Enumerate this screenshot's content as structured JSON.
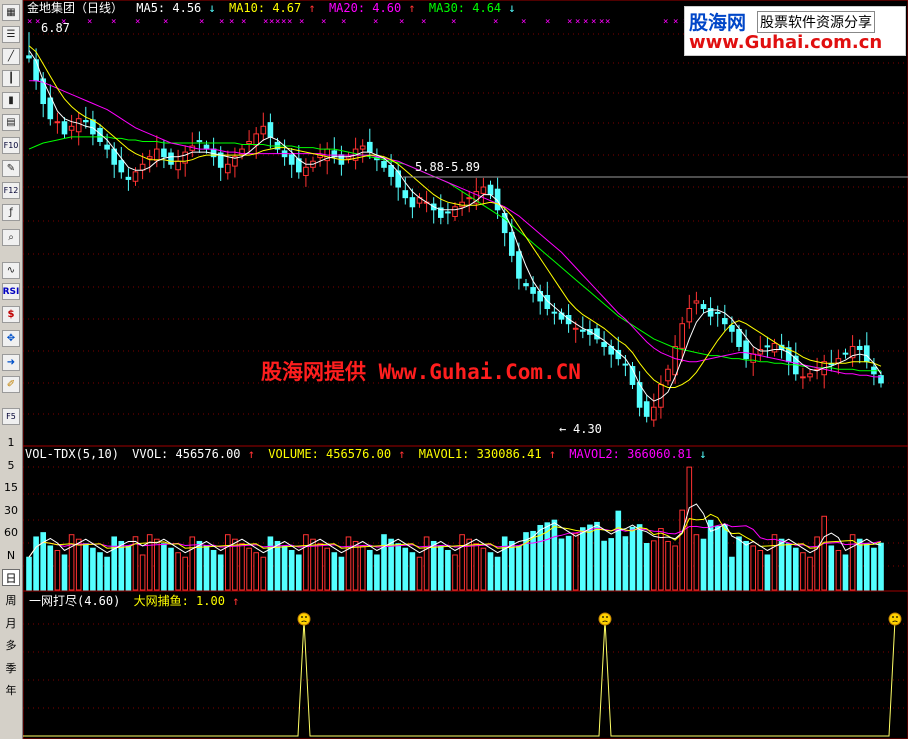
{
  "toolbar": {
    "icons": [
      "grid-icon",
      "list-icon",
      "line-chart-icon",
      "candle-chart-icon",
      "bar-chart-icon",
      "table-icon",
      "f10-icon",
      "notes-icon",
      "f12-icon",
      "function-icon",
      "zoom-icon",
      "indicator-icon",
      "rsi-icon",
      "dollar-icon",
      "move-icon",
      "export-icon",
      "pencil-icon",
      "f5-icon"
    ],
    "labels": {
      "rsi": "RSI",
      "f10": "F10",
      "f12": "F12",
      "f5": "F5"
    },
    "periods": [
      "1",
      "5",
      "15",
      "30",
      "60",
      "N",
      "日",
      "周",
      "月",
      "多",
      "季",
      "年"
    ],
    "selected_period": "日"
  },
  "main_legend": {
    "stock": "金地集团（日线）",
    "ma5": "MA5: 4.56",
    "ma5_arrow": "↓",
    "ma10": "MA10: 4.67",
    "ma10_arrow": "↑",
    "ma20": "MA20: 4.60",
    "ma20_arrow": "↑",
    "ma30": "MA30: 4.64",
    "ma30_arrow": "↓"
  },
  "vol_legend": {
    "name": "VOL-TDX(5,10)",
    "vvol": "VVOL: 456576.00",
    "vvol_arrow": "↑",
    "volume": "VOLUME: 456576.00",
    "volume_arrow": "↑",
    "mavol1": "MAVOL1: 330086.41",
    "mavol1_arrow": "↑",
    "mavol2": "MAVOL2: 366060.81",
    "mavol2_arrow": "↓"
  },
  "ind_legend": {
    "name": "一网打尽(4.60)",
    "value": "大网捕鱼: 1.00",
    "arrow": "↑"
  },
  "annotations": {
    "high": "6.87",
    "range": "5.88-5.89",
    "low": "4.30",
    "arrow": "←",
    "xmarks": "×"
  },
  "watermark": "股海网提供 Www.Guhai.Com.CN",
  "logo": {
    "brand": "股海网",
    "slogan": "股票软件资源分享",
    "url": "www.Guhai.com.cn"
  },
  "colors": {
    "up": "#ff3232",
    "down": "#54ffff",
    "ma5": "#ffffff",
    "ma10": "#ffff00",
    "ma20": "#ff00ff",
    "ma30": "#00ff00",
    "grid": "#800000",
    "axis": "#a00000"
  },
  "chart_data": [
    {
      "type": "candlestick",
      "panel": "price",
      "note": "Approximate daily candles, ~120 sessions",
      "key_levels": {
        "high": 6.87,
        "range": [
          5.88,
          5.89
        ],
        "low": 4.3
      },
      "series_last": {
        "MA5": 4.56,
        "MA10": 4.67,
        "MA20": 4.6,
        "MA30": 4.64
      },
      "close": [
        6.7,
        6.55,
        6.4,
        6.3,
        6.28,
        6.2,
        6.25,
        6.3,
        6.28,
        6.2,
        6.15,
        6.1,
        6.0,
        5.95,
        5.9,
        5.95,
        6.0,
        6.05,
        6.1,
        6.05,
        6.0,
        6.02,
        6.08,
        6.12,
        6.15,
        6.1,
        6.05,
        5.98,
        6.0,
        6.05,
        6.1,
        6.15,
        6.2,
        6.25,
        6.18,
        6.1,
        6.05,
        6.0,
        5.95,
        5.98,
        6.02,
        6.06,
        6.1,
        6.05,
        6.0,
        6.05,
        6.1,
        6.12,
        6.08,
        6.03,
        5.98,
        5.92,
        5.85,
        5.78,
        5.72,
        5.78,
        5.75,
        5.7,
        5.65,
        5.68,
        5.72,
        5.75,
        5.78,
        5.82,
        5.85,
        5.8,
        5.7,
        5.55,
        5.4,
        5.25,
        5.2,
        5.15,
        5.1,
        5.05,
        5.02,
        4.98,
        4.95,
        4.92,
        4.9,
        4.88,
        4.85,
        4.8,
        4.75,
        4.72,
        4.68,
        4.55,
        4.4,
        4.34,
        4.4,
        4.55,
        4.65,
        4.8,
        4.95,
        5.05,
        5.1,
        5.05,
        5.0,
        5.02,
        4.95,
        4.9,
        4.8,
        4.72,
        4.75,
        4.78,
        4.8,
        4.82,
        4.78,
        4.7,
        4.62,
        4.6,
        4.62,
        4.65,
        4.7,
        4.68,
        4.72,
        4.75,
        4.8,
        4.78,
        4.7,
        4.62,
        4.56
      ],
      "MA5": [
        6.75,
        6.68,
        6.55,
        6.45,
        6.35,
        6.3,
        6.28,
        6.27,
        6.25,
        6.24,
        6.2,
        6.16,
        6.1,
        6.04,
        5.98,
        5.96,
        5.96,
        5.98,
        6.02,
        6.04,
        6.05,
        6.05,
        6.06,
        6.08,
        6.08,
        6.08,
        6.07,
        6.06,
        6.05,
        6.04,
        6.05,
        6.08,
        6.12,
        6.16,
        6.18,
        6.16,
        6.12,
        6.08,
        6.03,
        6.0,
        6.0,
        6.02,
        6.04,
        6.05,
        6.05,
        6.05,
        6.06,
        6.08,
        6.08,
        6.06,
        6.04,
        6.0,
        5.95,
        5.88,
        5.82,
        5.78,
        5.75,
        5.72,
        5.7,
        5.7,
        5.7,
        5.71,
        5.73,
        5.76,
        5.8,
        5.8,
        5.76,
        5.68,
        5.58,
        5.45,
        5.33,
        5.23,
        5.16,
        5.1,
        5.06,
        5.02,
        4.98,
        4.95,
        4.92,
        4.9,
        4.87,
        4.84,
        4.8,
        4.76,
        4.72,
        4.65,
        4.55,
        4.48,
        4.44,
        4.46,
        4.5,
        4.6,
        4.72,
        4.85,
        4.96,
        5.02,
        5.04,
        5.04,
        5.02,
        4.98,
        4.92,
        4.86,
        4.8,
        4.77,
        4.77,
        4.78,
        4.78,
        4.76,
        4.72,
        4.68,
        4.65,
        4.64,
        4.66,
        4.67,
        4.69,
        4.71,
        4.74,
        4.75,
        4.74,
        4.69,
        4.62
      ],
      "MA10": [
        6.78,
        6.74,
        6.66,
        6.58,
        6.5,
        6.43,
        6.38,
        6.34,
        6.31,
        6.29,
        6.26,
        6.22,
        6.18,
        6.14,
        6.1,
        6.07,
        6.05,
        6.03,
        6.03,
        6.03,
        6.02,
        6.02,
        6.02,
        6.03,
        6.05,
        6.06,
        6.06,
        6.06,
        6.06,
        6.06,
        6.06,
        6.06,
        6.07,
        6.09,
        6.1,
        6.11,
        6.11,
        6.1,
        6.09,
        6.08,
        6.07,
        6.06,
        6.05,
        6.04,
        6.03,
        6.03,
        6.04,
        6.05,
        6.06,
        6.06,
        6.05,
        6.03,
        6.0,
        5.96,
        5.92,
        5.88,
        5.84,
        5.8,
        5.77,
        5.75,
        5.74,
        5.73,
        5.73,
        5.73,
        5.74,
        5.75,
        5.74,
        5.71,
        5.66,
        5.59,
        5.52,
        5.45,
        5.38,
        5.31,
        5.24,
        5.17,
        5.1,
        5.05,
        5.01,
        4.98,
        4.95,
        4.92,
        4.88,
        4.84,
        4.81,
        4.76,
        4.69,
        4.63,
        4.58,
        4.55,
        4.53,
        4.53,
        4.55,
        4.58,
        4.63,
        4.7,
        4.77,
        4.84,
        4.9,
        4.95,
        4.97,
        4.95,
        4.92,
        4.89,
        4.86,
        4.83,
        4.8,
        4.78,
        4.76,
        4.73,
        4.71,
        4.7,
        4.69,
        4.69,
        4.69,
        4.69,
        4.7,
        4.7,
        4.7,
        4.69,
        4.67
      ],
      "MA20": [
        6.55,
        6.55,
        6.54,
        6.52,
        6.5,
        6.48,
        6.46,
        6.44,
        6.42,
        6.4,
        6.38,
        6.36,
        6.33,
        6.3,
        6.27,
        6.24,
        6.22,
        6.2,
        6.18,
        6.16,
        6.14,
        6.13,
        6.12,
        6.11,
        6.1,
        6.1,
        6.1,
        6.09,
        6.08,
        6.08,
        6.07,
        6.07,
        6.07,
        6.07,
        6.07,
        6.07,
        6.07,
        6.07,
        6.07,
        6.07,
        6.07,
        6.07,
        6.06,
        6.06,
        6.06,
        6.06,
        6.06,
        6.06,
        6.06,
        6.05,
        6.04,
        6.03,
        6.02,
        6.0,
        5.98,
        5.96,
        5.94,
        5.92,
        5.9,
        5.88,
        5.86,
        5.84,
        5.82,
        5.8,
        5.78,
        5.76,
        5.74,
        5.72,
        5.69,
        5.66,
        5.62,
        5.58,
        5.54,
        5.5,
        5.46,
        5.42,
        5.37,
        5.32,
        5.27,
        5.22,
        5.17,
        5.12,
        5.07,
        5.02,
        4.98,
        4.93,
        4.88,
        4.83,
        4.79,
        4.76,
        4.74,
        4.72,
        4.71,
        4.7,
        4.7,
        4.71,
        4.72,
        4.73,
        4.74,
        4.75,
        4.76,
        4.76,
        4.75,
        4.74,
        4.73,
        4.72,
        4.71,
        4.7,
        4.69,
        4.68,
        4.67,
        4.66,
        4.65,
        4.64,
        4.63,
        4.62,
        4.62,
        4.61,
        4.61,
        4.6,
        4.6
      ],
      "MA30": [
        6.1,
        6.12,
        6.14,
        6.15,
        6.16,
        6.17,
        6.18,
        6.18,
        6.18,
        6.18,
        6.18,
        6.18,
        6.17,
        6.17,
        6.16,
        6.16,
        6.15,
        6.15,
        6.15,
        6.14,
        6.14,
        6.14,
        6.14,
        6.14,
        6.14,
        6.14,
        6.14,
        6.14,
        6.14,
        6.14,
        6.13,
        6.13,
        6.13,
        6.13,
        6.12,
        6.12,
        6.12,
        6.12,
        6.11,
        6.11,
        6.11,
        6.1,
        6.1,
        6.1,
        6.09,
        6.08,
        6.07,
        6.06,
        6.05,
        6.04,
        6.03,
        6.02,
        6.01,
        6.0,
        5.98,
        5.96,
        5.94,
        5.92,
        5.9,
        5.88,
        5.85,
        5.82,
        5.79,
        5.76,
        5.73,
        5.7,
        5.67,
        5.64,
        5.6,
        5.56,
        5.52,
        5.48,
        5.44,
        5.4,
        5.36,
        5.32,
        5.28,
        5.24,
        5.2,
        5.16,
        5.12,
        5.08,
        5.04,
        5.0,
        4.97,
        4.94,
        4.91,
        4.88,
        4.85,
        4.83,
        4.81,
        4.79,
        4.78,
        4.77,
        4.76,
        4.75,
        4.74,
        4.74,
        4.73,
        4.72,
        4.72,
        4.71,
        4.71,
        4.7,
        4.7,
        4.69,
        4.69,
        4.68,
        4.68,
        4.67,
        4.67,
        4.66,
        4.66,
        4.66,
        4.65,
        4.65,
        4.65,
        4.64,
        4.64,
        4.64,
        4.64
      ]
    },
    {
      "type": "bar",
      "panel": "volume",
      "series_last": {
        "VVOL": 456576.0,
        "VOLUME": 456576.0,
        "MAVOL1": 330086.41,
        "MAVOL2": 366060.81
      },
      "peak_volume_approx": 1200000
    },
    {
      "type": "line",
      "panel": "indicator",
      "series": [
        {
          "name": "大网捕鱼",
          "last": 1.0
        }
      ],
      "signal_positions": [
        0.318,
        0.658,
        0.985
      ],
      "ylim": [
        0,
        1
      ]
    }
  ]
}
